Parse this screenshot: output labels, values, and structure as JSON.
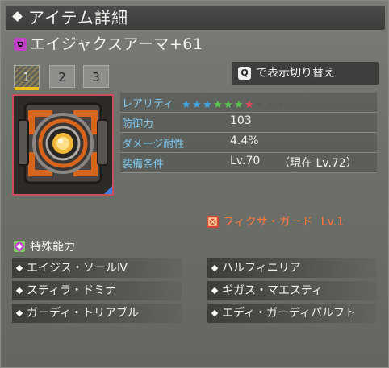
{
  "header": {
    "title": "アイテム詳細"
  },
  "item": {
    "name": "エイジャクスアーマ+61",
    "icon": "armor-type-icon"
  },
  "tabs": [
    {
      "label": "1",
      "active": true
    },
    {
      "label": "2",
      "active": false
    },
    {
      "label": "3",
      "active": false
    }
  ],
  "toggle": {
    "key": "Q",
    "label": "で表示切り替え"
  },
  "stats": {
    "rarity_label": "レアリティ",
    "rarity": {
      "value": 7,
      "max": 10,
      "colors": [
        "#40a8e8",
        "#40a8e8",
        "#40a8e8",
        "#58c850",
        "#58c850",
        "#58c850",
        "#e84a58",
        "#5a5c58",
        "#5a5c58",
        "#5a5c58"
      ]
    },
    "defense_label": "防御力",
    "defense_value": "103",
    "damage_res_label": "ダメージ耐性",
    "damage_res_value": "4.4%",
    "requirement_label": "装備条件",
    "requirement_value": "Lv.70",
    "requirement_current": "（現在  Lv.72）"
  },
  "fixa": {
    "name": "フィクサ・ガード",
    "level": "Lv.1",
    "color": "#ff7a3c"
  },
  "special": {
    "label": "特殊能力",
    "abilities": [
      "エイジス・ソールⅣ",
      "ハルフィニリア",
      "スティラ・ドミナ",
      "ギガス・マエスティ",
      "ガーディ・トリアブル",
      "エディ・ガーディパルフト"
    ]
  }
}
